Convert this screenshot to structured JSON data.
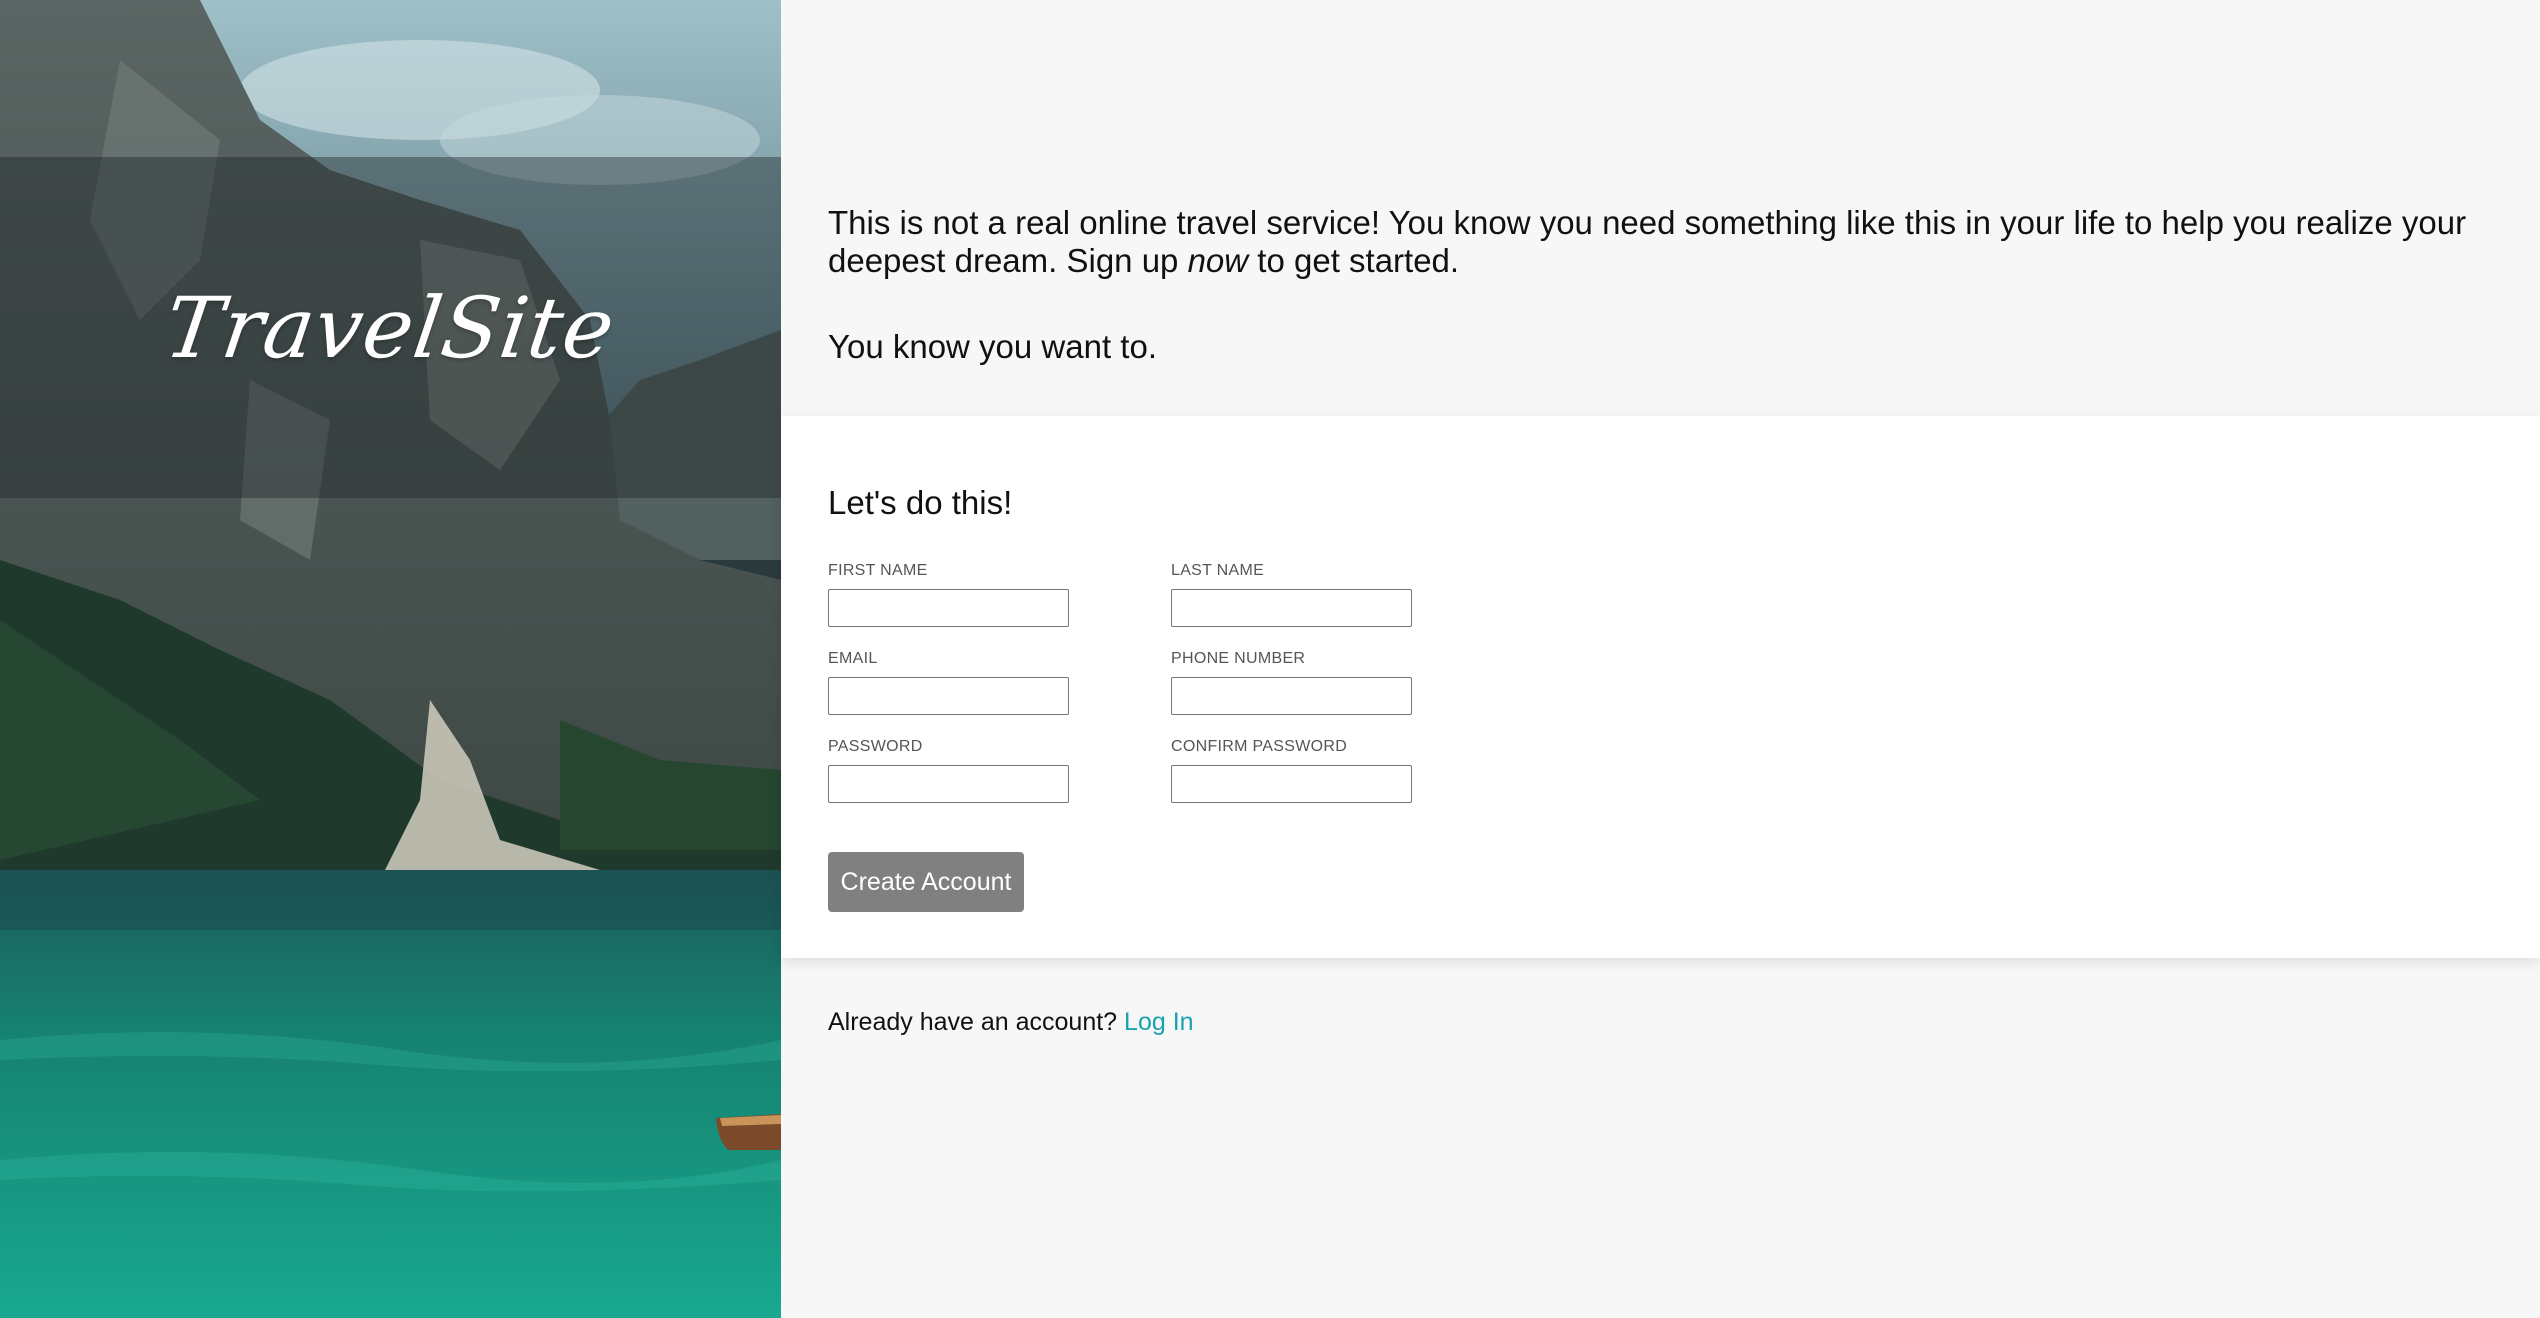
{
  "hero": {
    "logo": "TravelSite"
  },
  "intro": {
    "line_before": "This is not a real online travel service! You know you need something like this in your life to help you realize your deepest dream. Sign up ",
    "emphasis": "now",
    "line_after": " to get started.",
    "tagline": "You know you want to."
  },
  "form": {
    "heading": "Let's do this!",
    "fields": {
      "first_name": {
        "label": "FIRST NAME",
        "value": ""
      },
      "last_name": {
        "label": "LAST NAME",
        "value": ""
      },
      "email": {
        "label": "EMAIL",
        "value": ""
      },
      "phone": {
        "label": "PHONE NUMBER",
        "value": ""
      },
      "password": {
        "label": "PASSWORD",
        "value": ""
      },
      "confirm_password": {
        "label": "CONFIRM PASSWORD",
        "value": ""
      }
    },
    "submit_label": "Create Account"
  },
  "login": {
    "prompt": "Already have an account?",
    "link": "Log In"
  },
  "colors": {
    "link": "#17a2b0",
    "button": "#808080",
    "page_background": "#f7f7f7",
    "card_background": "#ffffff"
  }
}
